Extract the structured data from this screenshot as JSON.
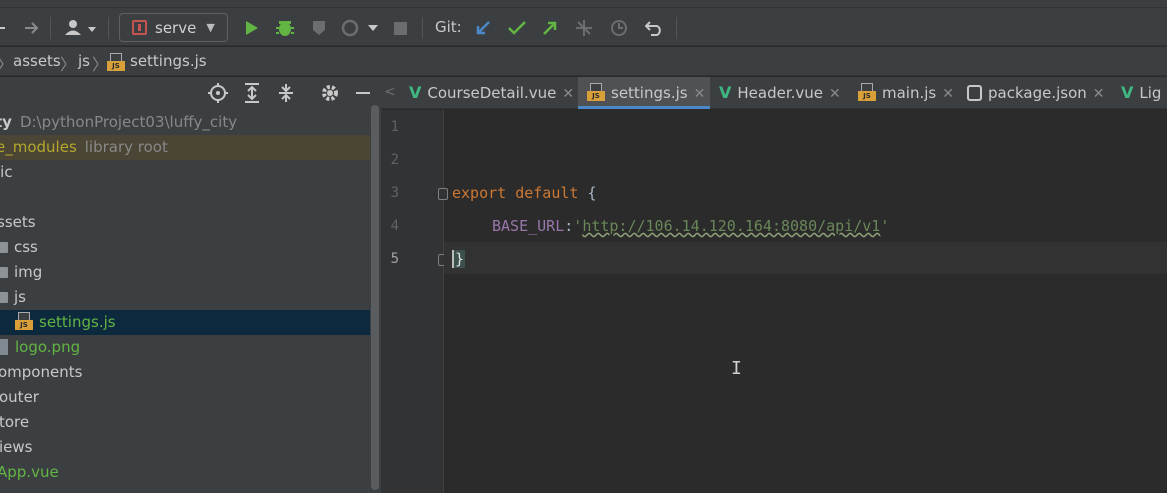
{
  "toolbar": {
    "run_config": "serve",
    "git_label": "Git:",
    "colors": {
      "run": "#62b543",
      "git_update": "#4a88c7",
      "git_commit": "#62b543",
      "git_push": "#62b543"
    }
  },
  "breadcrumb": [
    "assets",
    "js",
    "settings.js"
  ],
  "project_tree": [
    {
      "name": "ty",
      "hint": "D:\\pythonProject03\\luffy_city",
      "style": "bold"
    },
    {
      "name": "e_modules",
      "hint": "library root",
      "style": "olive",
      "state": "highlight"
    },
    {
      "name": "lic",
      "hint": ""
    },
    {
      "name": "",
      "hint": ""
    },
    {
      "name": "ssets",
      "hint": ""
    },
    {
      "name": "css",
      "hint": "",
      "icon": "folder-icon"
    },
    {
      "name": "img",
      "hint": "",
      "icon": "folder-icon"
    },
    {
      "name": "js",
      "hint": "",
      "icon": "folder-icon"
    },
    {
      "name": "settings.js",
      "hint": "",
      "style": "green",
      "icon": "js-file-icon",
      "state": "selected"
    },
    {
      "name": "logo.png",
      "hint": "",
      "style": "green",
      "icon": "image-file-icon"
    },
    {
      "name": "omponents",
      "hint": ""
    },
    {
      "name": "outer",
      "hint": ""
    },
    {
      "name": "tore",
      "hint": ""
    },
    {
      "name": "iews",
      "hint": ""
    },
    {
      "name": "App.vue",
      "hint": "",
      "style": "green"
    }
  ],
  "tabs": [
    {
      "label": "CourseDetail.vue",
      "icon": "vue-icon",
      "active": false
    },
    {
      "label": "settings.js",
      "icon": "js-file-icon",
      "active": true
    },
    {
      "label": "Header.vue",
      "icon": "vue-icon",
      "active": false
    },
    {
      "label": "main.js",
      "icon": "js-file-icon",
      "active": false
    },
    {
      "label": "package.json",
      "icon": "json-file-icon",
      "active": false
    },
    {
      "label": "Lig",
      "icon": "vue-icon",
      "active": false
    }
  ],
  "editor": {
    "line_numbers": [
      "1",
      "2",
      "3",
      "4",
      "5"
    ],
    "current_line": "5",
    "code": {
      "l3_kw1": "export",
      "l3_kw2": "default",
      "l3_brace": "{",
      "l4_prop": "BASE_URL",
      "l4_colon": ":",
      "l4_quote_open": "'",
      "l4_url": "http://106.14.120.164:8080/api/v1",
      "l4_quote_close": "'",
      "l5_brace": "}"
    }
  }
}
